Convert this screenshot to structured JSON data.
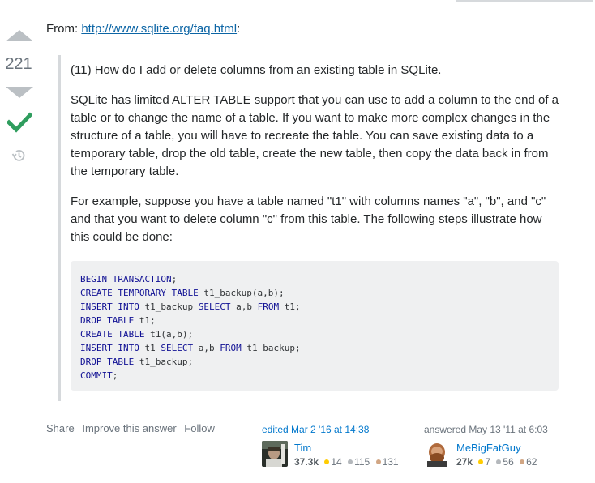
{
  "vote": {
    "score": "221"
  },
  "post": {
    "from_label": "From:",
    "from_link": "http://www.sqlite.org/faq.html",
    "from_suffix": ":",
    "quote": {
      "question": "(11) How do I add or delete columns from an existing table in SQLite.",
      "paragraph1": "SQLite has limited ALTER TABLE support that you can use to add a column to the end of a table or to change the name of a table. If you want to make more complex changes in the structure of a table, you will have to recreate the table. You can save existing data to a temporary table, drop the old table, create the new table, then copy the data back in from the temporary table.",
      "paragraph2": "For example, suppose you have a table named \"t1\" with columns names \"a\", \"b\", and \"c\" and that you want to delete column \"c\" from this table. The following steps illustrate how this could be done:"
    },
    "code_lines": [
      [
        {
          "t": "BEGIN TRANSACTION",
          "k": true
        },
        {
          "t": ";",
          "k": false
        }
      ],
      [
        {
          "t": "CREATE TEMPORARY TABLE",
          "k": true
        },
        {
          "t": " t1_backup(a,b);",
          "k": false
        }
      ],
      [
        {
          "t": "INSERT INTO",
          "k": true
        },
        {
          "t": " t1_backup ",
          "k": false
        },
        {
          "t": "SELECT",
          "k": true
        },
        {
          "t": " a,b ",
          "k": false
        },
        {
          "t": "FROM",
          "k": true
        },
        {
          "t": " t1;",
          "k": false
        }
      ],
      [
        {
          "t": "DROP TABLE",
          "k": true
        },
        {
          "t": " t1;",
          "k": false
        }
      ],
      [
        {
          "t": "CREATE TABLE",
          "k": true
        },
        {
          "t": " t1(a,b);",
          "k": false
        }
      ],
      [
        {
          "t": "INSERT INTO",
          "k": true
        },
        {
          "t": " t1 ",
          "k": false
        },
        {
          "t": "SELECT",
          "k": true
        },
        {
          "t": " a,b ",
          "k": false
        },
        {
          "t": "FROM",
          "k": true
        },
        {
          "t": " t1_backup;",
          "k": false
        }
      ],
      [
        {
          "t": "DROP TABLE",
          "k": true
        },
        {
          "t": " t1_backup;",
          "k": false
        }
      ],
      [
        {
          "t": "COMMIT",
          "k": true
        },
        {
          "t": ";",
          "k": false
        }
      ]
    ]
  },
  "menu": {
    "share": "Share",
    "improve": "Improve this answer",
    "follow": "Follow"
  },
  "editor": {
    "action": "edited Mar 2 '16 at 14:38",
    "name": "Tim",
    "reputation": "37.3k",
    "gold": "14",
    "silver": "115",
    "bronze": "131"
  },
  "author": {
    "action": "answered May 13 '11 at 6:03",
    "name": "MeBigFatGuy",
    "reputation": "27k",
    "gold": "7",
    "silver": "56",
    "bronze": "62"
  },
  "colors": {
    "gold": "#ffcc01",
    "silver": "#b4b8bc",
    "bronze": "#d1a684",
    "accepted": "#2f9d5e",
    "link": "#0077cc"
  }
}
